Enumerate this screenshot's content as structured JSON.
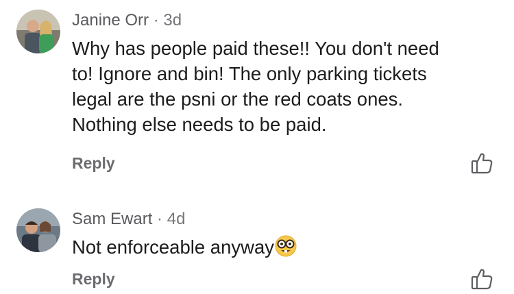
{
  "comments": [
    {
      "author": "Janine Orr",
      "separator": "·",
      "time": "3d",
      "lines": [
        "Why has people paid these!! You don't need",
        "to! Ignore and bin! The only parking tickets",
        "legal are the psni or the red coats ones.",
        "Nothing else needs to be paid."
      ],
      "reply_label": "Reply",
      "avatar_icon": "user-photo-couple",
      "like_icon": "thumbs-up-outline-icon"
    },
    {
      "author": "Sam Ewart",
      "separator": "·",
      "time": "4d",
      "text": "Not enforceable anyway",
      "emoji": "🤓",
      "emoji_icon": "nerd-face-emoji",
      "reply_label": "Reply",
      "avatar_icon": "user-photo-couple",
      "like_icon": "thumbs-up-outline-icon"
    }
  ],
  "colors": {
    "author": "#5a5a5e",
    "meta": "#76767a",
    "text": "#1c1c1e",
    "reply": "#6b6b70"
  }
}
